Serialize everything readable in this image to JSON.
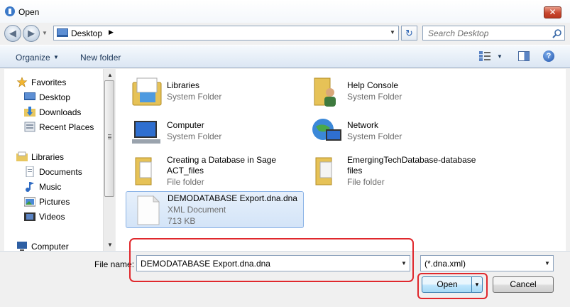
{
  "window": {
    "title": "Open",
    "close_symbol": "✕"
  },
  "address": {
    "location": "Desktop",
    "chevron": "▶",
    "dropdown": "▼",
    "refresh": "↻"
  },
  "nav_buttons": {
    "back": "◀",
    "forward": "▶",
    "history": "▼"
  },
  "search": {
    "placeholder": "Search Desktop"
  },
  "toolbar": {
    "organize_label": "Organize",
    "organize_arrow": "▼",
    "new_folder_label": "New folder",
    "views_arrow": "▼",
    "help_symbol": "?"
  },
  "navigation": {
    "favorites": {
      "label": "Favorites",
      "items": [
        "Desktop",
        "Downloads",
        "Recent Places"
      ]
    },
    "libraries": {
      "label": "Libraries",
      "items": [
        "Documents",
        "Music",
        "Pictures",
        "Videos"
      ]
    },
    "computer": {
      "label": "Computer"
    },
    "scroll_up": "▲",
    "scroll_down": "▼"
  },
  "items": [
    {
      "name": "Libraries",
      "type": "System Folder",
      "icon": "libraries-icon"
    },
    {
      "name": "Help Console",
      "type": "System Folder",
      "icon": "user-folder-icon"
    },
    {
      "name": "Computer",
      "type": "System Folder",
      "icon": "computer-icon"
    },
    {
      "name": "Network",
      "type": "System Folder",
      "icon": "network-icon"
    },
    {
      "name_line1": "Creating a Database in Sage",
      "name_line2": "ACT_files",
      "type": "File folder",
      "icon": "folder-icon"
    },
    {
      "name_line1": "EmergingTechDatabase-database",
      "name_line2": "files",
      "type": "File folder",
      "icon": "folder-icon"
    },
    {
      "name": "DEMODATABASE Export.dna.dna",
      "type": "XML Document",
      "size": "713 KB",
      "icon": "document-icon",
      "selected": true
    }
  ],
  "file_name": {
    "label": "File name:",
    "value": "DEMODATABASE Export.dna.dna",
    "dropdown": "▼"
  },
  "file_type": {
    "value": "(*.dna.xml)",
    "dropdown": "▼"
  },
  "buttons": {
    "open": "Open",
    "open_split": "▼",
    "cancel": "Cancel"
  },
  "colors": {
    "highlight": "#e0282d",
    "selection": "#d3e4f8",
    "accent": "#1e395b"
  }
}
